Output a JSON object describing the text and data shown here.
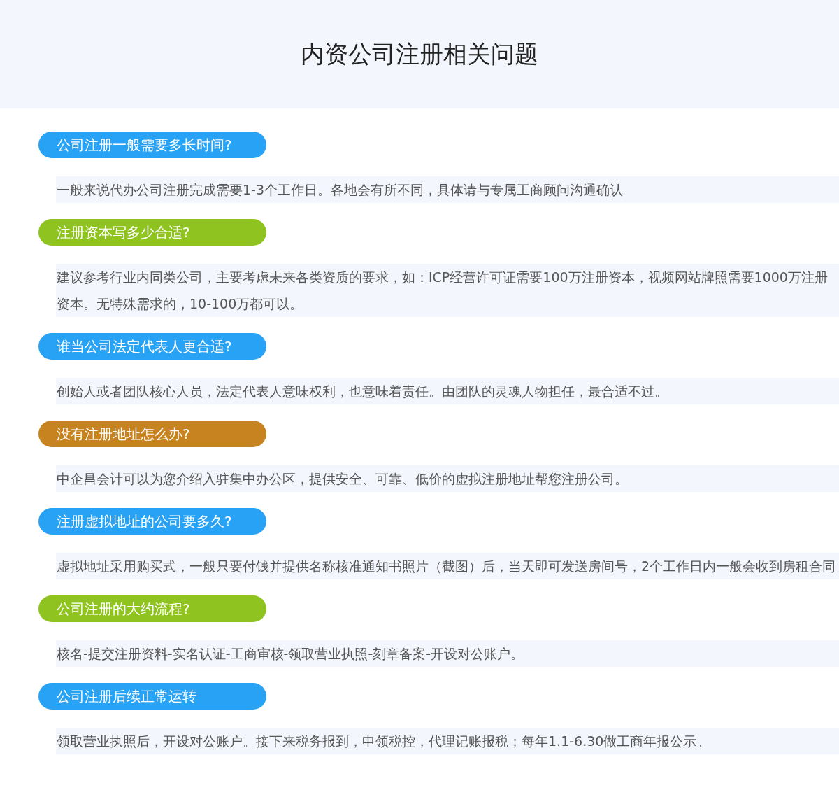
{
  "title": "内资公司注册相关问题",
  "faqs": [
    {
      "question": "公司注册一般需要多长时间?",
      "color": "#28a2f4",
      "answer": "一般来说代办公司注册完成需要1-3个工作日。各地会有所不同，具体请与专属工商顾问沟通确认"
    },
    {
      "question": "注册资本写多少合适?",
      "color": "#8fc31f",
      "answer": "建议参考行业内同类公司，主要考虑未来各类资质的要求，如：ICP经营许可证需要100万注册资本，视频网站牌照需要1000万注册资本。无特殊需求的，10-100万都可以。"
    },
    {
      "question": "谁当公司法定代表人更合适?",
      "color": "#28a2f4",
      "answer": "创始人或者团队核心人员，法定代表人意味权利，也意味着责任。由团队的灵魂人物担任，最合适不过。"
    },
    {
      "question": "没有注册地址怎么办?",
      "color": "#c6831f",
      "answer": "中企昌会计可以为您介绍入驻集中办公区，提供安全、可靠、低价的虚拟注册地址帮您注册公司。"
    },
    {
      "question": "注册虚拟地址的公司要多久?",
      "color": "#28a2f4",
      "answer": "虚拟地址采用购买式，一般只要付钱并提供名称核准通知书照片（截图）后，当天即可发送房间号，2个工作日内一般会收到房租合同"
    },
    {
      "question": "公司注册的大约流程?",
      "color": "#8fc31f",
      "answer": "核名-提交注册资料-实名认证-工商审核-领取营业执照-刻章备案-开设对公账户。"
    },
    {
      "question": "公司注册后续正常运转",
      "color": "#28a2f4",
      "answer": "领取营业执照后，开设对公账户。接下来税务报到，申领税控，代理记账报税；每年1.1-6.30做工商年报公示。"
    }
  ]
}
